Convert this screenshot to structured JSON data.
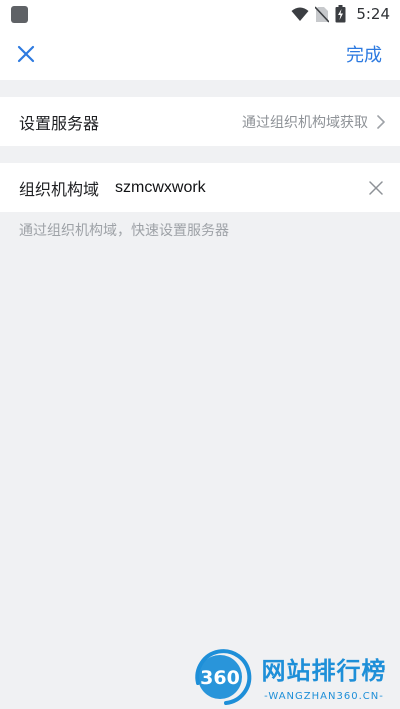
{
  "status_bar": {
    "time": "5:24",
    "icons": [
      "app-square-icon",
      "wifi-icon",
      "no-sim-icon",
      "battery-charging-icon"
    ]
  },
  "nav": {
    "close_icon": "close-icon",
    "done_label": "完成",
    "accent_color": "#2d7ae0"
  },
  "server_row": {
    "label": "设置服务器",
    "value": "通过组织机构域获取",
    "chevron_icon": "chevron-right-icon"
  },
  "domain_row": {
    "label": "组织机构域",
    "value": "szmcwxwork",
    "clear_icon": "clear-icon"
  },
  "hint": "通过组织机构域，快速设置服务器",
  "watermark": {
    "logo_number": "360",
    "title": "网站排行榜",
    "url": "-WANGZHAN360.CN-"
  }
}
